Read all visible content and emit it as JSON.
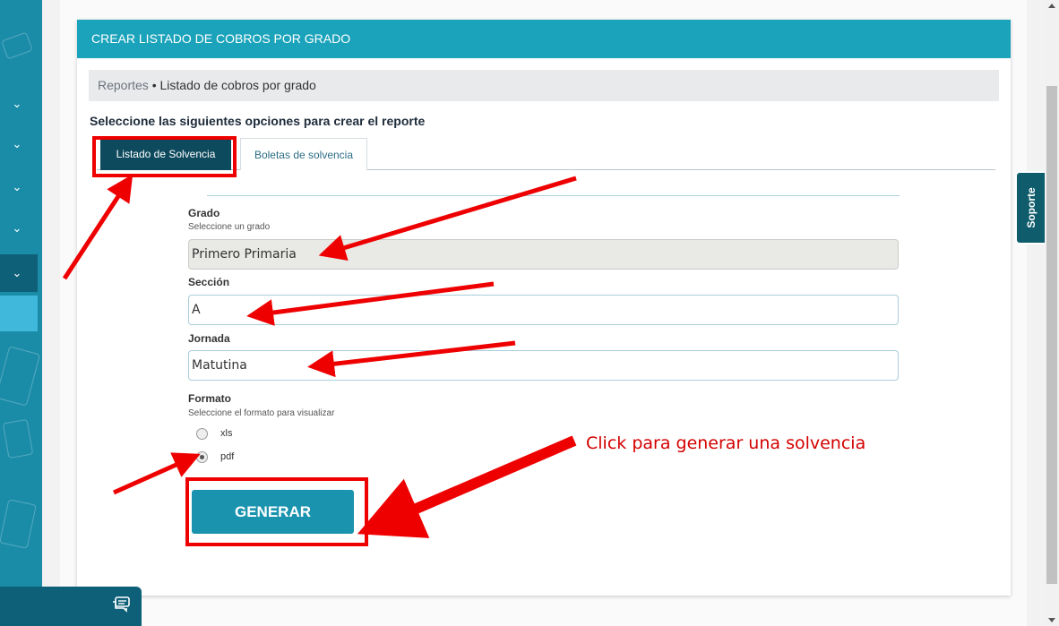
{
  "card": {
    "title": "CREAR LISTADO DE COBROS POR GRADO"
  },
  "breadcrumb": {
    "link": "Reportes",
    "separator": "•",
    "current": "Listado de cobros por grado"
  },
  "subtitle": "Seleccione las siguientes opciones para crear el reporte",
  "tabs": [
    {
      "label": "Listado de Solvencia",
      "active": true
    },
    {
      "label": "Boletas de solvencia",
      "active": false
    }
  ],
  "form": {
    "grado": {
      "label": "Grado",
      "help": "Seleccione un grado",
      "value": "Primero Primaria"
    },
    "seccion": {
      "label": "Sección",
      "value": "A"
    },
    "jornada": {
      "label": "Jornada",
      "value": "Matutina"
    },
    "formato": {
      "label": "Formato",
      "help": "Seleccione el formato para visualizar",
      "options": [
        {
          "label": "xls",
          "checked": false
        },
        {
          "label": "pdf",
          "checked": true
        }
      ]
    },
    "submit_label": "GENERAR"
  },
  "soporte_label": "Soporte",
  "annotation": {
    "text": "Click para generar una solvencia",
    "color": "#e00000"
  },
  "colors": {
    "header": "#1ba3bb",
    "sidebar": "#1b8ca8",
    "tab_active": "#0e4a5e",
    "button": "#1a93ae"
  }
}
